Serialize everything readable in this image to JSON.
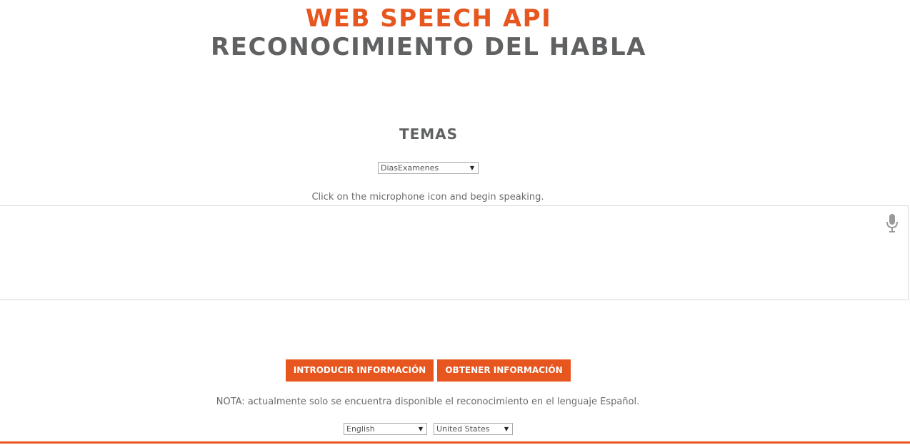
{
  "header": {
    "title_line1": "WEB SPEECH API",
    "title_line2": "RECONOCIMIENTO DEL HABLA"
  },
  "topics": {
    "heading": "TEMAS",
    "selected": "DiasExamenes"
  },
  "recognition": {
    "instructions": "Click on the microphone icon and begin speaking.",
    "transcript": "",
    "mic_icon": "microphone-icon"
  },
  "actions": {
    "introduce_label": "INTRODUCIR INFORMACIÓN",
    "obtain_label": "OBTENER INFORMACIÓN"
  },
  "note": "NOTA: actualmente solo se encuentra disponible el reconocimiento en el lenguaje Español.",
  "language": {
    "selected_language": "English",
    "selected_dialect": "United States"
  },
  "colors": {
    "accent": "#e8561f",
    "heading_gray": "#5f6162",
    "text_gray": "#6b6b6b",
    "border": "#d9d9d9"
  }
}
